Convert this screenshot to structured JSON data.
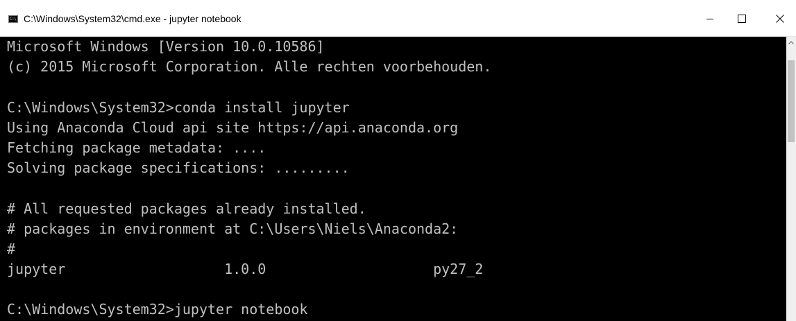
{
  "window": {
    "title": "C:\\Windows\\System32\\cmd.exe - jupyter  notebook",
    "icon_glyph": "C:\\",
    "icon": "cmd-icon",
    "buttons": [
      "minimize-icon",
      "maximize-icon",
      "close-icon"
    ]
  },
  "console": {
    "lines": [
      "Microsoft Windows [Version 10.0.10586]",
      "(c) 2015 Microsoft Corporation. Alle rechten voorbehouden.",
      "",
      "C:\\Windows\\System32>conda install jupyter",
      "Using Anaconda Cloud api site https://api.anaconda.org",
      "Fetching package metadata: ....",
      "Solving package specifications: .........",
      "",
      "# All requested packages already installed.",
      "# packages in environment at C:\\Users\\Niels\\Anaconda2:",
      "#",
      "jupyter                   1.0.0                    py27_2",
      "",
      "C:\\Windows\\System32>jupyter notebook"
    ]
  },
  "colors": {
    "console_bg": "#000000",
    "console_fg": "#c0c0c0",
    "titlebar_bg": "#ffffff"
  }
}
